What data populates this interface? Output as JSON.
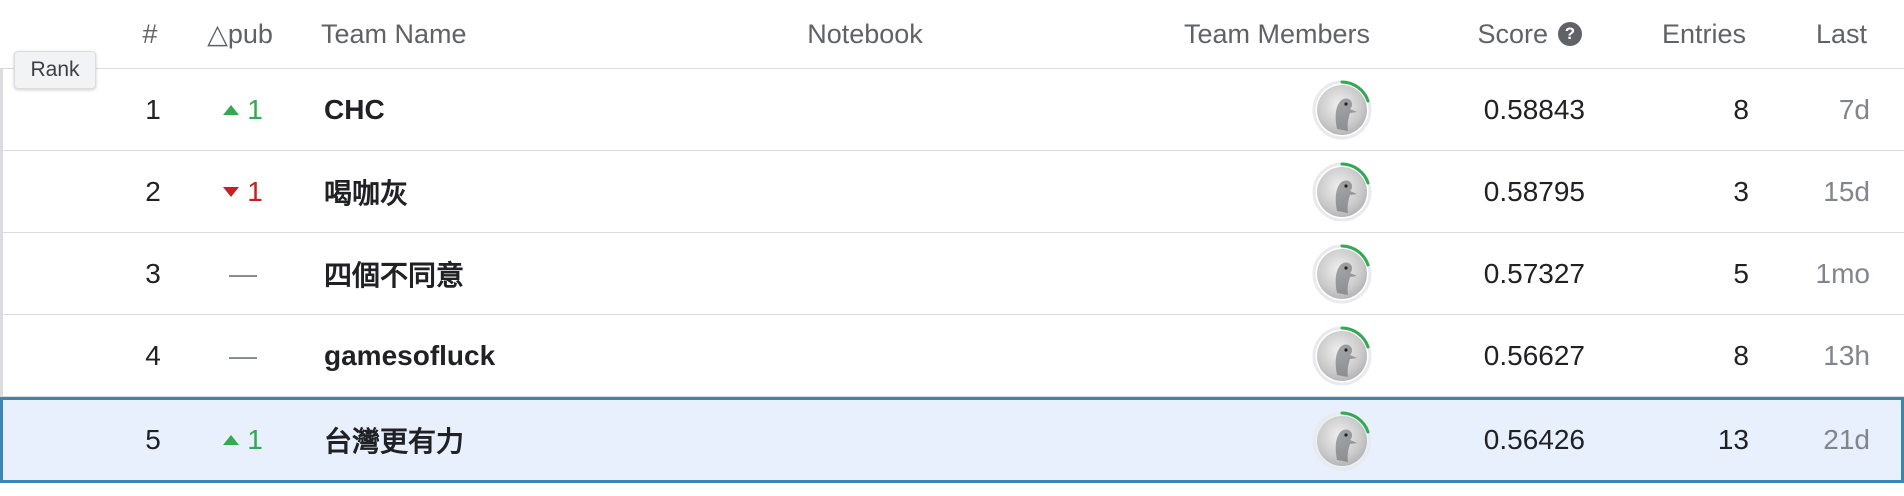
{
  "tooltip": {
    "label": "Rank"
  },
  "header": {
    "rank": "#",
    "delta": "△pub",
    "team": "Team Name",
    "notebook": "Notebook",
    "members": "Team Members",
    "score": "Score",
    "entries": "Entries",
    "last": "Last"
  },
  "icons": {
    "help": "question-circle-icon",
    "avatar": "bird-avatar-icon"
  },
  "colors": {
    "up": "#34a853",
    "down": "#c5221f",
    "highlight_border": "#3c84b4",
    "highlight_bg": "#e8f0fe"
  },
  "rows": [
    {
      "rank": "1",
      "delta": "1",
      "dir": "up",
      "team": "CHC",
      "score": "0.58843",
      "entries": "8",
      "last": "7d"
    },
    {
      "rank": "2",
      "delta": "1",
      "dir": "down",
      "team": "喝咖灰",
      "score": "0.58795",
      "entries": "3",
      "last": "15d"
    },
    {
      "rank": "3",
      "delta": "—",
      "dir": "none",
      "team": "四個不同意",
      "score": "0.57327",
      "entries": "5",
      "last": "1mo"
    },
    {
      "rank": "4",
      "delta": "—",
      "dir": "none",
      "team": "gamesofluck",
      "score": "0.56627",
      "entries": "8",
      "last": "13h"
    },
    {
      "rank": "5",
      "delta": "1",
      "dir": "up",
      "team": "台灣更有力",
      "score": "0.56426",
      "entries": "13",
      "last": "21d"
    }
  ]
}
